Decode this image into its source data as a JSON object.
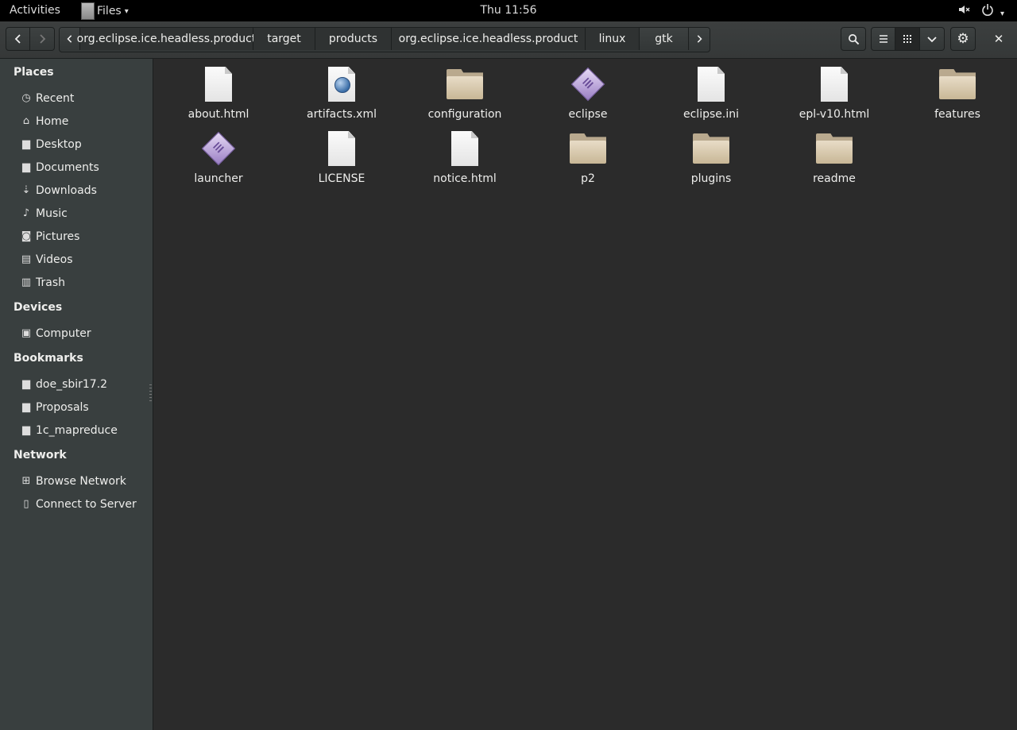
{
  "topbar": {
    "activities": "Activities",
    "app_menu": "Files",
    "clock": "Thu 11:56",
    "icons": [
      "volume-muted-icon",
      "power-icon"
    ]
  },
  "header": {
    "back_icon": "chevron-left-icon",
    "forward_icon": "chevron-right-icon",
    "breadcrumbs": [
      "org.eclipse.ice.headless.product",
      "target",
      "products",
      "org.eclipse.ice.headless.product",
      "linux",
      "gtk"
    ],
    "view_buttons": [
      "search-icon",
      "list-view-icon",
      "grid-view-icon",
      "chevron-down-icon",
      "gear-icon",
      "close-icon"
    ]
  },
  "sidebar": {
    "places_title": "Places",
    "places": [
      {
        "label": "Recent",
        "icon": "clock-icon"
      },
      {
        "label": "Home",
        "icon": "home-icon"
      },
      {
        "label": "Desktop",
        "icon": "folder-icon"
      },
      {
        "label": "Documents",
        "icon": "folder-icon"
      },
      {
        "label": "Downloads",
        "icon": "download-icon"
      },
      {
        "label": "Music",
        "icon": "music-icon"
      },
      {
        "label": "Pictures",
        "icon": "camera-icon"
      },
      {
        "label": "Videos",
        "icon": "film-icon"
      },
      {
        "label": "Trash",
        "icon": "trash-icon"
      }
    ],
    "devices_title": "Devices",
    "devices": [
      {
        "label": "Computer",
        "icon": "drive-icon"
      }
    ],
    "bookmarks_title": "Bookmarks",
    "bookmarks": [
      {
        "label": "doe_sbir17.2",
        "icon": "folder-icon"
      },
      {
        "label": "Proposals",
        "icon": "folder-icon"
      },
      {
        "label": "1c_mapreduce",
        "icon": "folder-icon"
      }
    ],
    "network_title": "Network",
    "network": [
      {
        "label": "Browse Network",
        "icon": "network-icon"
      },
      {
        "label": "Connect to Server",
        "icon": "server-icon"
      }
    ]
  },
  "files": [
    {
      "name": "about.html",
      "type": "doc"
    },
    {
      "name": "artifacts.xml",
      "type": "xml"
    },
    {
      "name": "configuration",
      "type": "folder"
    },
    {
      "name": "eclipse",
      "type": "exec"
    },
    {
      "name": "eclipse.ini",
      "type": "doc"
    },
    {
      "name": "epl-v10.html",
      "type": "doc"
    },
    {
      "name": "features",
      "type": "folder"
    },
    {
      "name": "launcher",
      "type": "exec"
    },
    {
      "name": "LICENSE",
      "type": "doc"
    },
    {
      "name": "notice.html",
      "type": "doc"
    },
    {
      "name": "p2",
      "type": "folder"
    },
    {
      "name": "plugins",
      "type": "folder"
    },
    {
      "name": "readme",
      "type": "folder"
    }
  ]
}
